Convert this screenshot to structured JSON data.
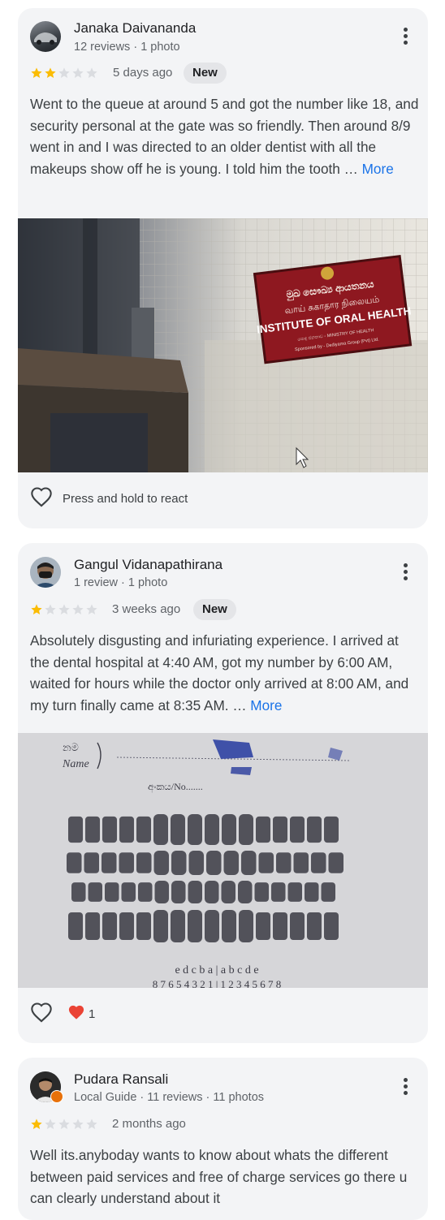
{
  "reviews": [
    {
      "name": "Janaka Daivananda",
      "meta": "12 reviews · 1 photo",
      "rating": 2,
      "when": "5 days ago",
      "badge": "New",
      "text": "Went to the queue at around 5 and got the number like 18, and security personal at the gate was so friendly. Then around 8/9 went in and I was directed to an older dentist with all the makeups show off he is young. I told him the tooth … ",
      "more": "More",
      "photo": {
        "sign_line1": "මුඛ සෞඛ්‍ය ආයතනය",
        "sign_line2": "வாய் சுகாதார நிலையம்",
        "sign_line3": "INSTITUTE OF ORAL HEALTH",
        "sign_line4": "පොදු ජනතාව - MINISTRY OF HEALTH",
        "sign_line5": "Sponsored by - Dediyama Group (Pvt) Ltd."
      },
      "react_label": "Press and hold to react"
    },
    {
      "name": "Gangul Vidanapathirana",
      "meta": "1 review · 1 photo",
      "rating": 1,
      "when": "3 weeks ago",
      "badge": "New",
      "text": "Absolutely disgusting and infuriating experience. I arrived at the dental hospital at 4:40 AM, got my number by 6:00 AM, waited for hours while the doctor only arrived at 8:00 AM, and my turn finally came at 8:35 AM. … ",
      "more": "More",
      "photo": {
        "label_si": "නම",
        "label_name": "Name",
        "label_no": "අංකය/No.......",
        "primary_letters": "e d c b a | a b c d e",
        "permanent_numbers": "8 7 6 5 4 3 2 1 | 1 2 3 4 5 6 7 8"
      },
      "reaction_count": "1"
    },
    {
      "name": "Pudara Ransali",
      "meta": "Local Guide · 11 reviews · 11 photos",
      "rating": 1,
      "when": "2 months ago",
      "text": "Well its.anyboday wants to know about whats the different between paid services and free of charge services go there u can clearly understand about it"
    }
  ],
  "colors": {
    "star_filled": "#fbbc04",
    "star_empty": "#dadce0",
    "link": "#1a73e8",
    "heart_red": "#ea4335"
  }
}
